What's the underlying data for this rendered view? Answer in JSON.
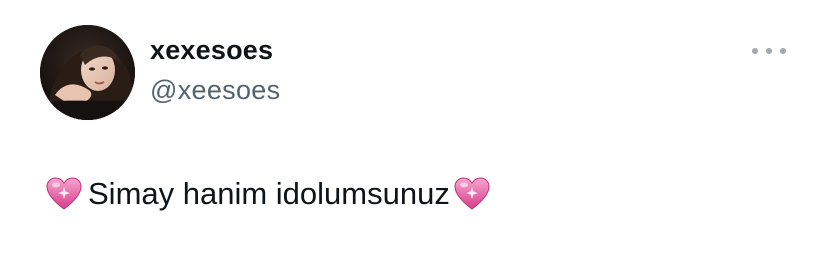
{
  "tweet": {
    "display_name": "xexesoes",
    "handle": "@xeesoes",
    "body": "Simay hanim idolumsunuz",
    "leading_emoji": "sparkling-heart-icon",
    "trailing_emoji": "sparkling-heart-icon",
    "more_icon": "more-options-icon"
  },
  "colors": {
    "background": "#ffffff",
    "name_text": "#0f1419",
    "handle_text": "#536471",
    "more_icon": "#a0a8b0",
    "heart_pink": "#e0529c"
  }
}
